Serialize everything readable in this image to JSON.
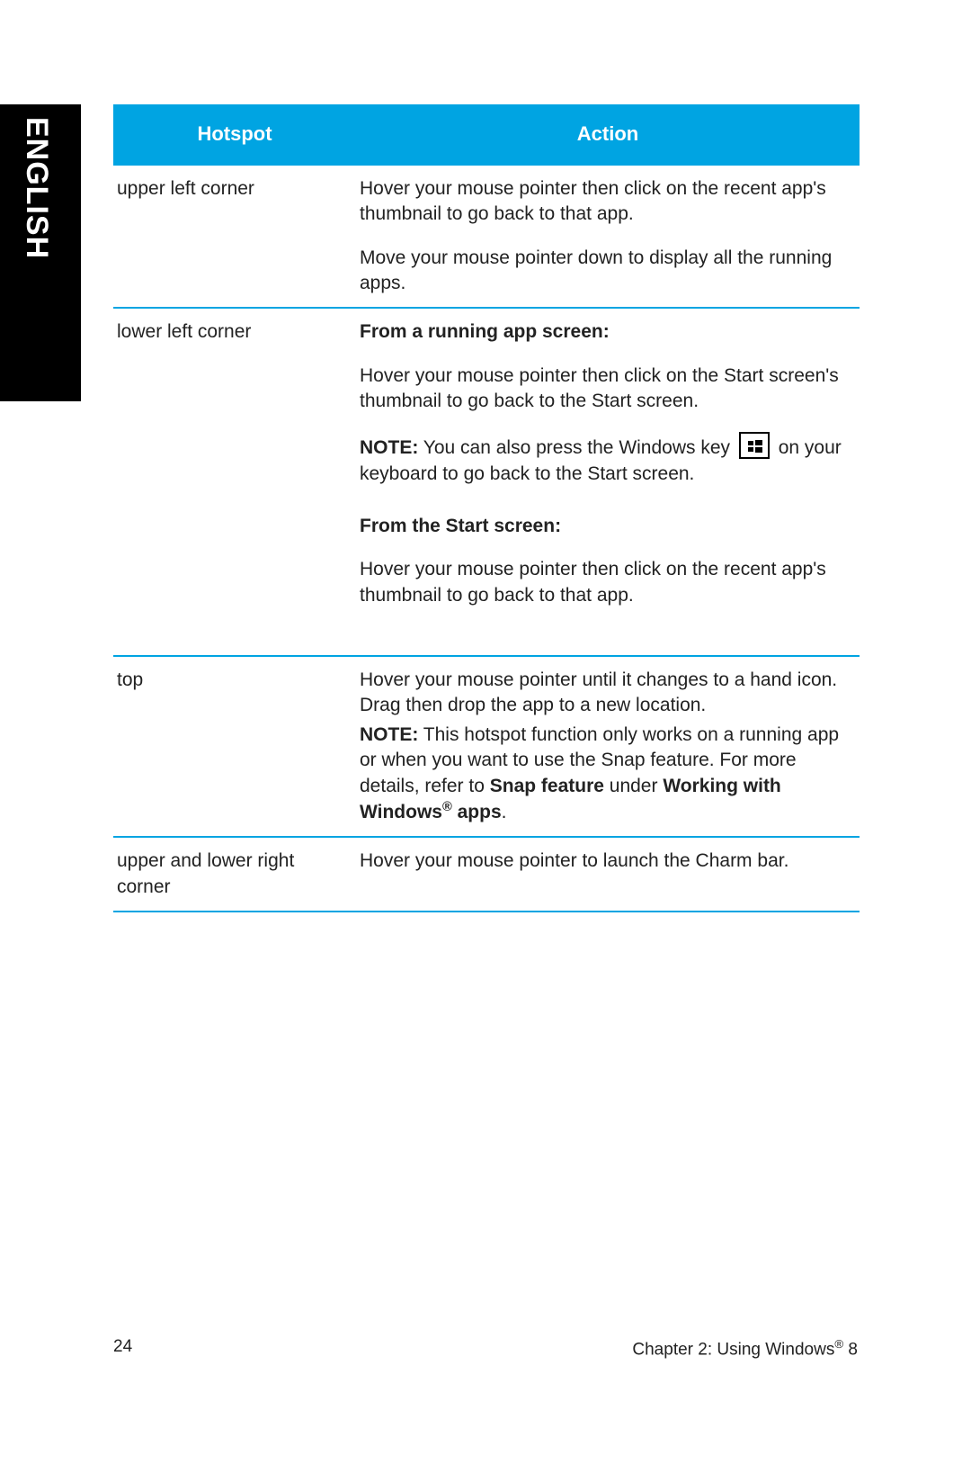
{
  "language_tab": "ENGLISH",
  "headers": {
    "hotspot": "Hotspot",
    "action": "Action"
  },
  "rows": {
    "r1": {
      "hotspot": "upper left corner",
      "a1": "Hover your mouse pointer then click on the recent app's thumbnail to go back to that app.",
      "a2": "Move your mouse pointer down to display all the running apps."
    },
    "r2": {
      "hotspot": "lower left corner",
      "h1": "From a running app screen:",
      "a1": "Hover your mouse pointer then click on the Start screen's thumbnail to go back to the Start screen.",
      "note_label": "NOTE:",
      "note_pre": "  You can also press the Windows key ",
      "note_post": " on your keyboard to go back to the Start screen.",
      "h2": "From the Start screen:",
      "a2": "Hover your mouse pointer then click on the recent app's thumbnail to go back to that app."
    },
    "r3": {
      "hotspot": "top",
      "a1": "Hover your mouse pointer until it changes to a hand icon. Drag then drop the app to a new location.",
      "note_label": "NOTE:",
      "note_text": "  This hotspot function only works on a running app or when you want to use the Snap feature. For more details, refer to ",
      "bold1": "Snap feature",
      "mid": " under ",
      "bold2": "Working with Windows",
      "reg": "®",
      "bold3": " apps",
      "end": "."
    },
    "r4": {
      "hotspot": "upper and lower right corner",
      "a1": "Hover your mouse pointer to launch the Charm bar."
    }
  },
  "footer": {
    "page": "24",
    "chapter_pre": "Chapter 2: Using Windows",
    "reg": "®",
    "chapter_post": " 8"
  }
}
